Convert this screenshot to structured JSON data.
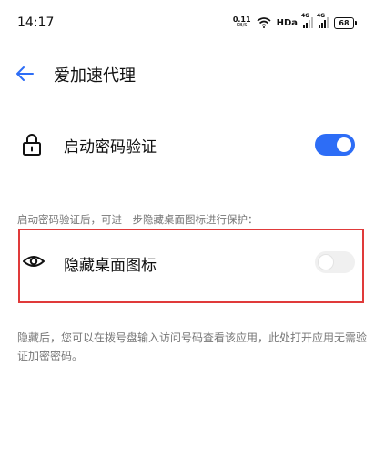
{
  "status_bar": {
    "time": "14:17",
    "net_speed_value": "0.11",
    "net_speed_unit": "KB/S",
    "hd_label": "HDa",
    "sim1_label": "4G",
    "sim2_label": "4G",
    "battery_level": "68"
  },
  "header": {
    "title": "爱加速代理",
    "back_icon": "arrow-left-icon"
  },
  "settings": {
    "password_verify": {
      "label": "启动密码验证",
      "icon": "lock-icon",
      "enabled": true
    },
    "hint_text": "启动密码验证后，可进一步隐藏桌面图标进行保护：",
    "hide_icon": {
      "label": "隐藏桌面图标",
      "icon": "eye-icon",
      "enabled": false
    },
    "description": "隐藏后，您可以在拨号盘输入访问号码查看该应用，此处打开应用无需验证加密密码。"
  },
  "colors": {
    "accent": "#2d6df6",
    "highlight_border": "#e03a3a",
    "hint_text": "#777777"
  }
}
